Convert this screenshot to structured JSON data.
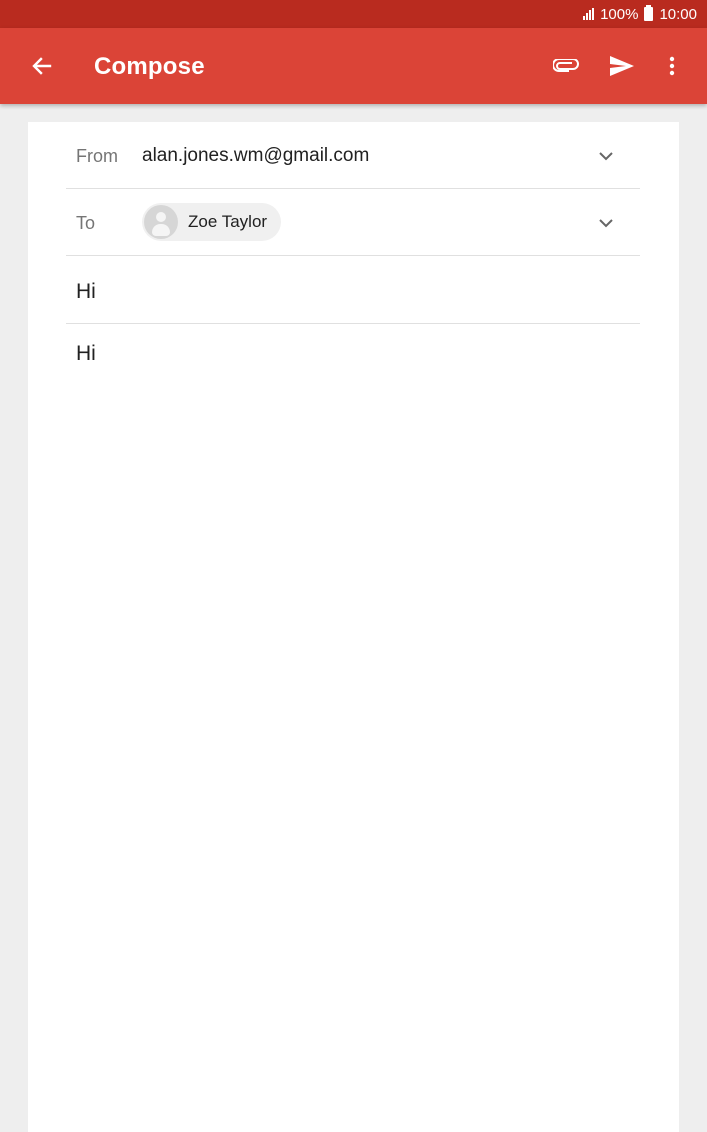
{
  "status_bar": {
    "battery": "100%",
    "time": "10:00"
  },
  "app_bar": {
    "title": "Compose",
    "icons": {
      "back": "arrow-back-icon",
      "attach": "paperclip-icon",
      "send": "send-icon",
      "more": "more-vert-icon"
    }
  },
  "compose": {
    "from_label": "From",
    "from_value": "alan.jones.wm@gmail.com",
    "to_label": "To",
    "recipients": [
      {
        "name": "Zoe Taylor"
      }
    ],
    "subject": "Hi",
    "body": "Hi"
  },
  "colors": {
    "status_bar": "#b92b1f",
    "app_bar": "#db4437",
    "background": "#eeeeee",
    "sheet": "#ffffff"
  }
}
